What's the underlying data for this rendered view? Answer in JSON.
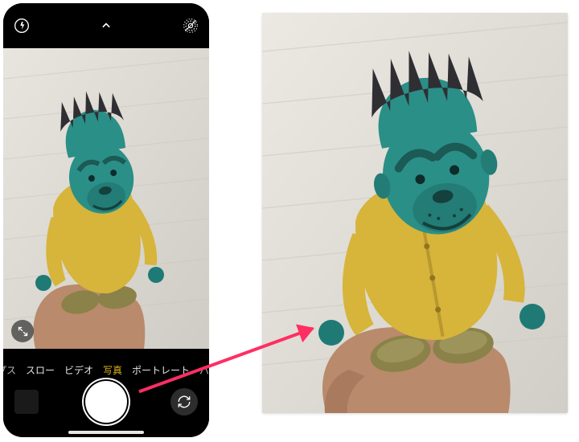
{
  "camera_ui": {
    "flash_state": "auto",
    "live_photo": "off",
    "modes": [
      {
        "label": "プス",
        "selected": false,
        "partial": true
      },
      {
        "label": "スロー",
        "selected": false
      },
      {
        "label": "ビデオ",
        "selected": false
      },
      {
        "label": "写真",
        "selected": true
      },
      {
        "label": "ポートレート",
        "selected": false
      },
      {
        "label": "パノ",
        "selected": false,
        "partial": true
      }
    ]
  },
  "icons": {
    "flash": "flash-icon",
    "chevron": "chevron-up-icon",
    "live": "live-photo-off-icon",
    "expand": "expand-icon",
    "flip": "camera-flip-icon"
  },
  "arrow_annotation": {
    "color": "#ff2e63",
    "from": "shutter-button",
    "to": "result-photo"
  },
  "photo_subject": {
    "description": "Hand holding a cartoon vinyl figure with teal head, spiky dark hair, yellow raincoat, teal hands and olive shoes, against a light textured wall."
  }
}
